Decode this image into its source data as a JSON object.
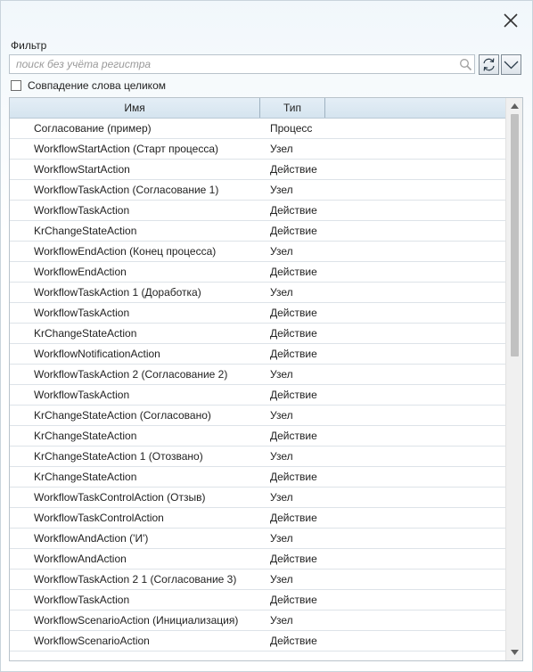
{
  "filter": {
    "label": "Фильтр",
    "placeholder": "поиск без учёта регистра",
    "value": ""
  },
  "whole_word": {
    "label": "Совпадение слова целиком",
    "checked": false
  },
  "columns": {
    "name": "Имя",
    "type": "Тип"
  },
  "rows": [
    {
      "name": "Согласование (пример)",
      "type": "Процесс"
    },
    {
      "name": "WorkflowStartAction (Старт процесса)",
      "type": "Узел"
    },
    {
      "name": "WorkflowStartAction",
      "type": "Действие"
    },
    {
      "name": "WorkflowTaskAction (Согласование 1)",
      "type": "Узел"
    },
    {
      "name": "WorkflowTaskAction",
      "type": "Действие"
    },
    {
      "name": "KrChangeStateAction",
      "type": "Действие"
    },
    {
      "name": "WorkflowEndAction (Конец процесса)",
      "type": "Узел"
    },
    {
      "name": "WorkflowEndAction",
      "type": "Действие"
    },
    {
      "name": "WorkflowTaskAction 1 (Доработка)",
      "type": "Узел"
    },
    {
      "name": "WorkflowTaskAction",
      "type": "Действие"
    },
    {
      "name": "KrChangeStateAction",
      "type": "Действие"
    },
    {
      "name": "WorkflowNotificationAction",
      "type": "Действие"
    },
    {
      "name": "WorkflowTaskAction 2 (Согласование 2)",
      "type": "Узел"
    },
    {
      "name": "WorkflowTaskAction",
      "type": "Действие"
    },
    {
      "name": "KrChangeStateAction (Согласовано)",
      "type": "Узел"
    },
    {
      "name": "KrChangeStateAction",
      "type": "Действие"
    },
    {
      "name": "KrChangeStateAction 1 (Отозвано)",
      "type": "Узел"
    },
    {
      "name": "KrChangeStateAction",
      "type": "Действие"
    },
    {
      "name": "WorkflowTaskControlAction (Отзыв)",
      "type": "Узел"
    },
    {
      "name": "WorkflowTaskControlAction",
      "type": "Действие"
    },
    {
      "name": "WorkflowAndAction ('И')",
      "type": "Узел"
    },
    {
      "name": "WorkflowAndAction",
      "type": "Действие"
    },
    {
      "name": "WorkflowTaskAction 2 1 (Согласование 3)",
      "type": "Узел"
    },
    {
      "name": "WorkflowTaskAction",
      "type": "Действие"
    },
    {
      "name": "WorkflowScenarioAction (Инициализация)",
      "type": "Узел"
    },
    {
      "name": "WorkflowScenarioAction",
      "type": "Действие"
    }
  ],
  "icons": {
    "close": "close-icon",
    "search": "search-icon",
    "refresh": "refresh-icon",
    "dropdown": "chevron-down-icon"
  },
  "colors": {
    "header_bg": "#d9e7f1",
    "border": "#b9c3cb",
    "row_divider": "#dde3e8"
  }
}
